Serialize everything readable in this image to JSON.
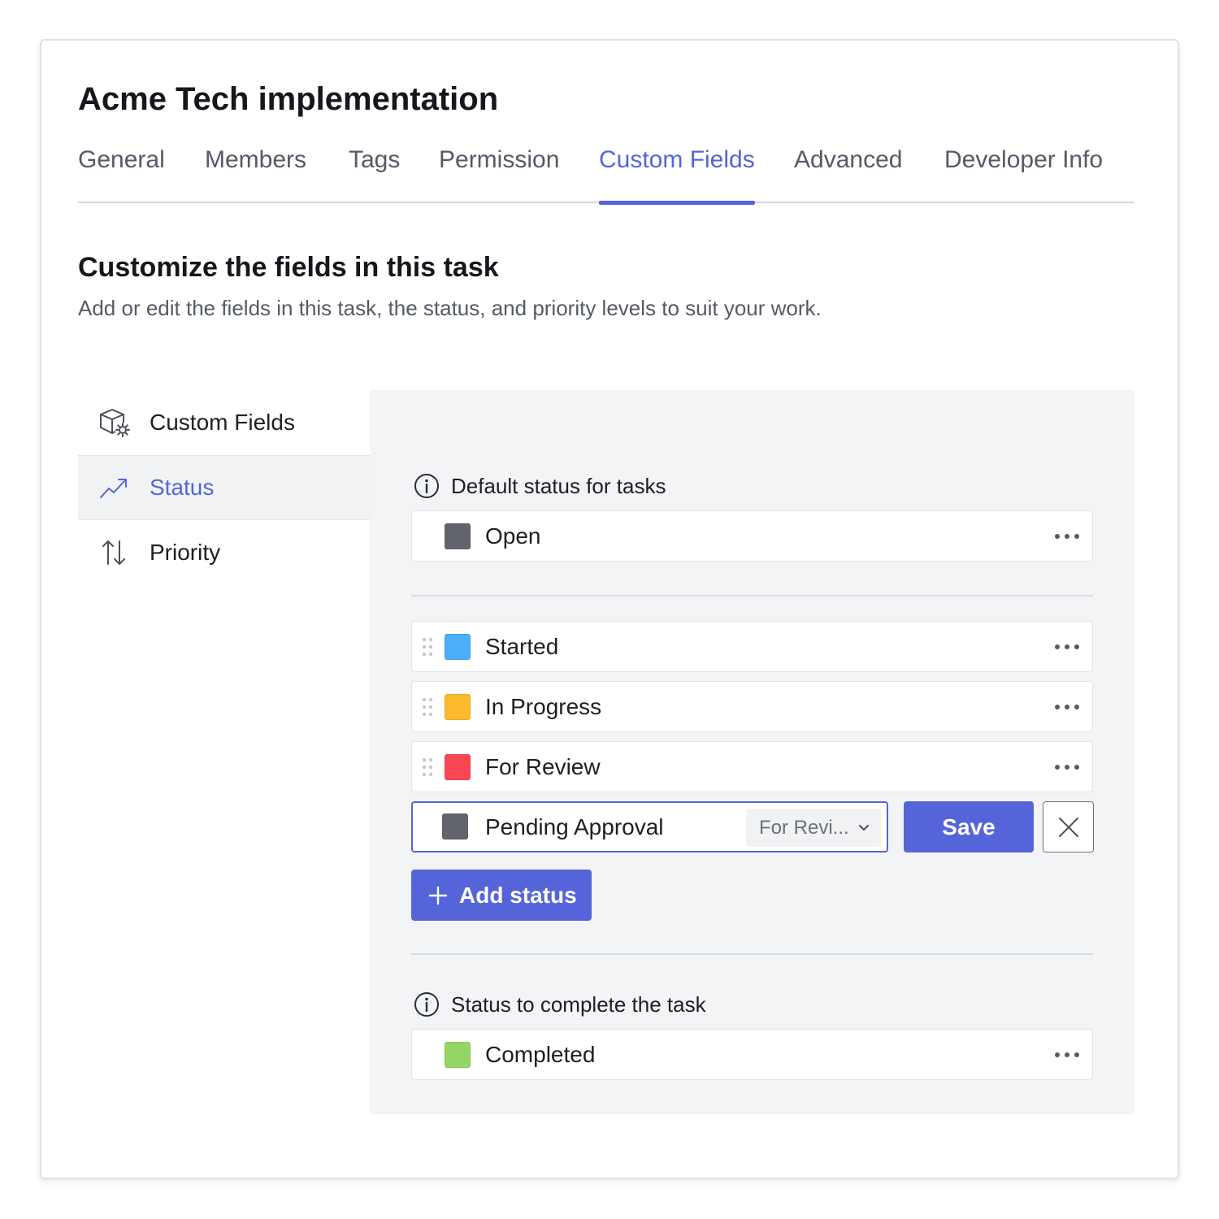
{
  "page": {
    "title": "Acme Tech implementation"
  },
  "tabs": [
    {
      "label": "General",
      "active": false
    },
    {
      "label": "Members",
      "active": false
    },
    {
      "label": "Tags",
      "active": false
    },
    {
      "label": "Permission",
      "active": false
    },
    {
      "label": "Custom Fields",
      "active": true
    },
    {
      "label": "Advanced",
      "active": false
    },
    {
      "label": "Developer Info",
      "active": false
    }
  ],
  "section": {
    "title": "Customize the fields in this task",
    "description": "Add or edit the fields in this task, the status, and priority levels to suit your work."
  },
  "side_nav": [
    {
      "label": "Custom Fields",
      "icon": "cube-gear-icon",
      "selected": false
    },
    {
      "label": "Status",
      "icon": "trend-up-icon",
      "selected": true
    },
    {
      "label": "Priority",
      "icon": "sort-arrows-icon",
      "selected": false
    }
  ],
  "default_status": {
    "label": "Default status for tasks",
    "icon": "info-icon",
    "item": {
      "label": "Open",
      "color": "#62646b"
    }
  },
  "statuses": [
    {
      "label": "Started",
      "color": "#4aaef9"
    },
    {
      "label": "In Progress",
      "color": "#fcb92c"
    },
    {
      "label": "For Review",
      "color": "#f84654"
    }
  ],
  "editing": {
    "value": "Pending Approval",
    "color": "#62646b",
    "after_select": "For Revi...",
    "save_label": "Save",
    "cancel_icon": "close-icon"
  },
  "add_status_label": "Add status",
  "complete_status": {
    "label": "Status to complete the task",
    "icon": "info-icon",
    "item": {
      "label": "Completed",
      "color": "#95d563"
    }
  },
  "colors": {
    "accent": "#5565d9",
    "panel_bg": "#f3f4f6"
  }
}
